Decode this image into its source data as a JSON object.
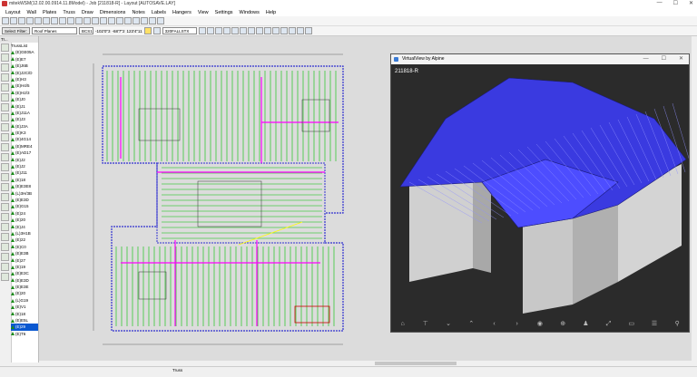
{
  "titlebar": {
    "title": "mitekWSM(12.02.00.0914.11.8Model) - Job [211818-R] - Layout [AUTOSAVE.LAY]",
    "minimize": "—",
    "restore": "☐",
    "close": "✕"
  },
  "menu": [
    "Layout",
    "Wall",
    "Plates",
    "Truss",
    "Draw",
    "Dimensions",
    "Notes",
    "Labels",
    "Hangers",
    "View",
    "Settings",
    "Windows",
    "Help"
  ],
  "toolbar2": {
    "select_filter": "Select Filter:",
    "filter_value": "Roof Planes",
    "coord_mode": "BCS1",
    "x": "-102'0\"3",
    "y": "-68'7\"2",
    "z": "123'4\"11",
    "layer": "320FALLSTX"
  },
  "leftpanel": {
    "header": "Tr...",
    "list_title": "TrussList",
    "items": [
      "(E)GE05A",
      "(E)E7",
      "(E)J6B",
      "(E)J2C/D",
      "(E)H3",
      "(E)H4/5",
      "(E)H2/3",
      "(E)J0",
      "(E)J1",
      "(E)J11A",
      "(E)J3",
      "(E)J3A",
      "(E)K3",
      "(E)4G14",
      "(E)MRE4",
      "(E)AD17",
      "(E)J2",
      "(E)J2",
      "(E)J11",
      "(E)18",
      "(E)E3E8",
      "(L)3H/3B",
      "(E)E3D",
      "(E)G15",
      "(E)24",
      "(E)20",
      "(E)J4",
      "(L)3H1B",
      "(E)22",
      "(E)C0",
      "(E)E3B",
      "(E)27",
      "(E)19",
      "(E)E3C",
      "(E)E3D",
      "(E)E3E",
      "(E)20",
      "(L)G19",
      "(E)V1",
      "(E)18",
      "(E)E5L",
      "(E)29",
      "(E)T6"
    ],
    "selected_index": 41
  },
  "status": {
    "tab": "Truss"
  },
  "virtualview": {
    "title": "VirtualView by Alpine",
    "label": "211818-R",
    "toolbar": [
      "home",
      "scissors",
      "chevron-down",
      "chevron-up",
      "arrow-left",
      "arrow-right",
      "eye",
      "zoom",
      "figure",
      "rotate",
      "level",
      "layers",
      "walk"
    ]
  },
  "colors": {
    "truss": "#00c000",
    "plate": "#ff00ff",
    "line": "#ff00ff",
    "roof": "#4040ff",
    "wall": "#d8d8d8"
  }
}
